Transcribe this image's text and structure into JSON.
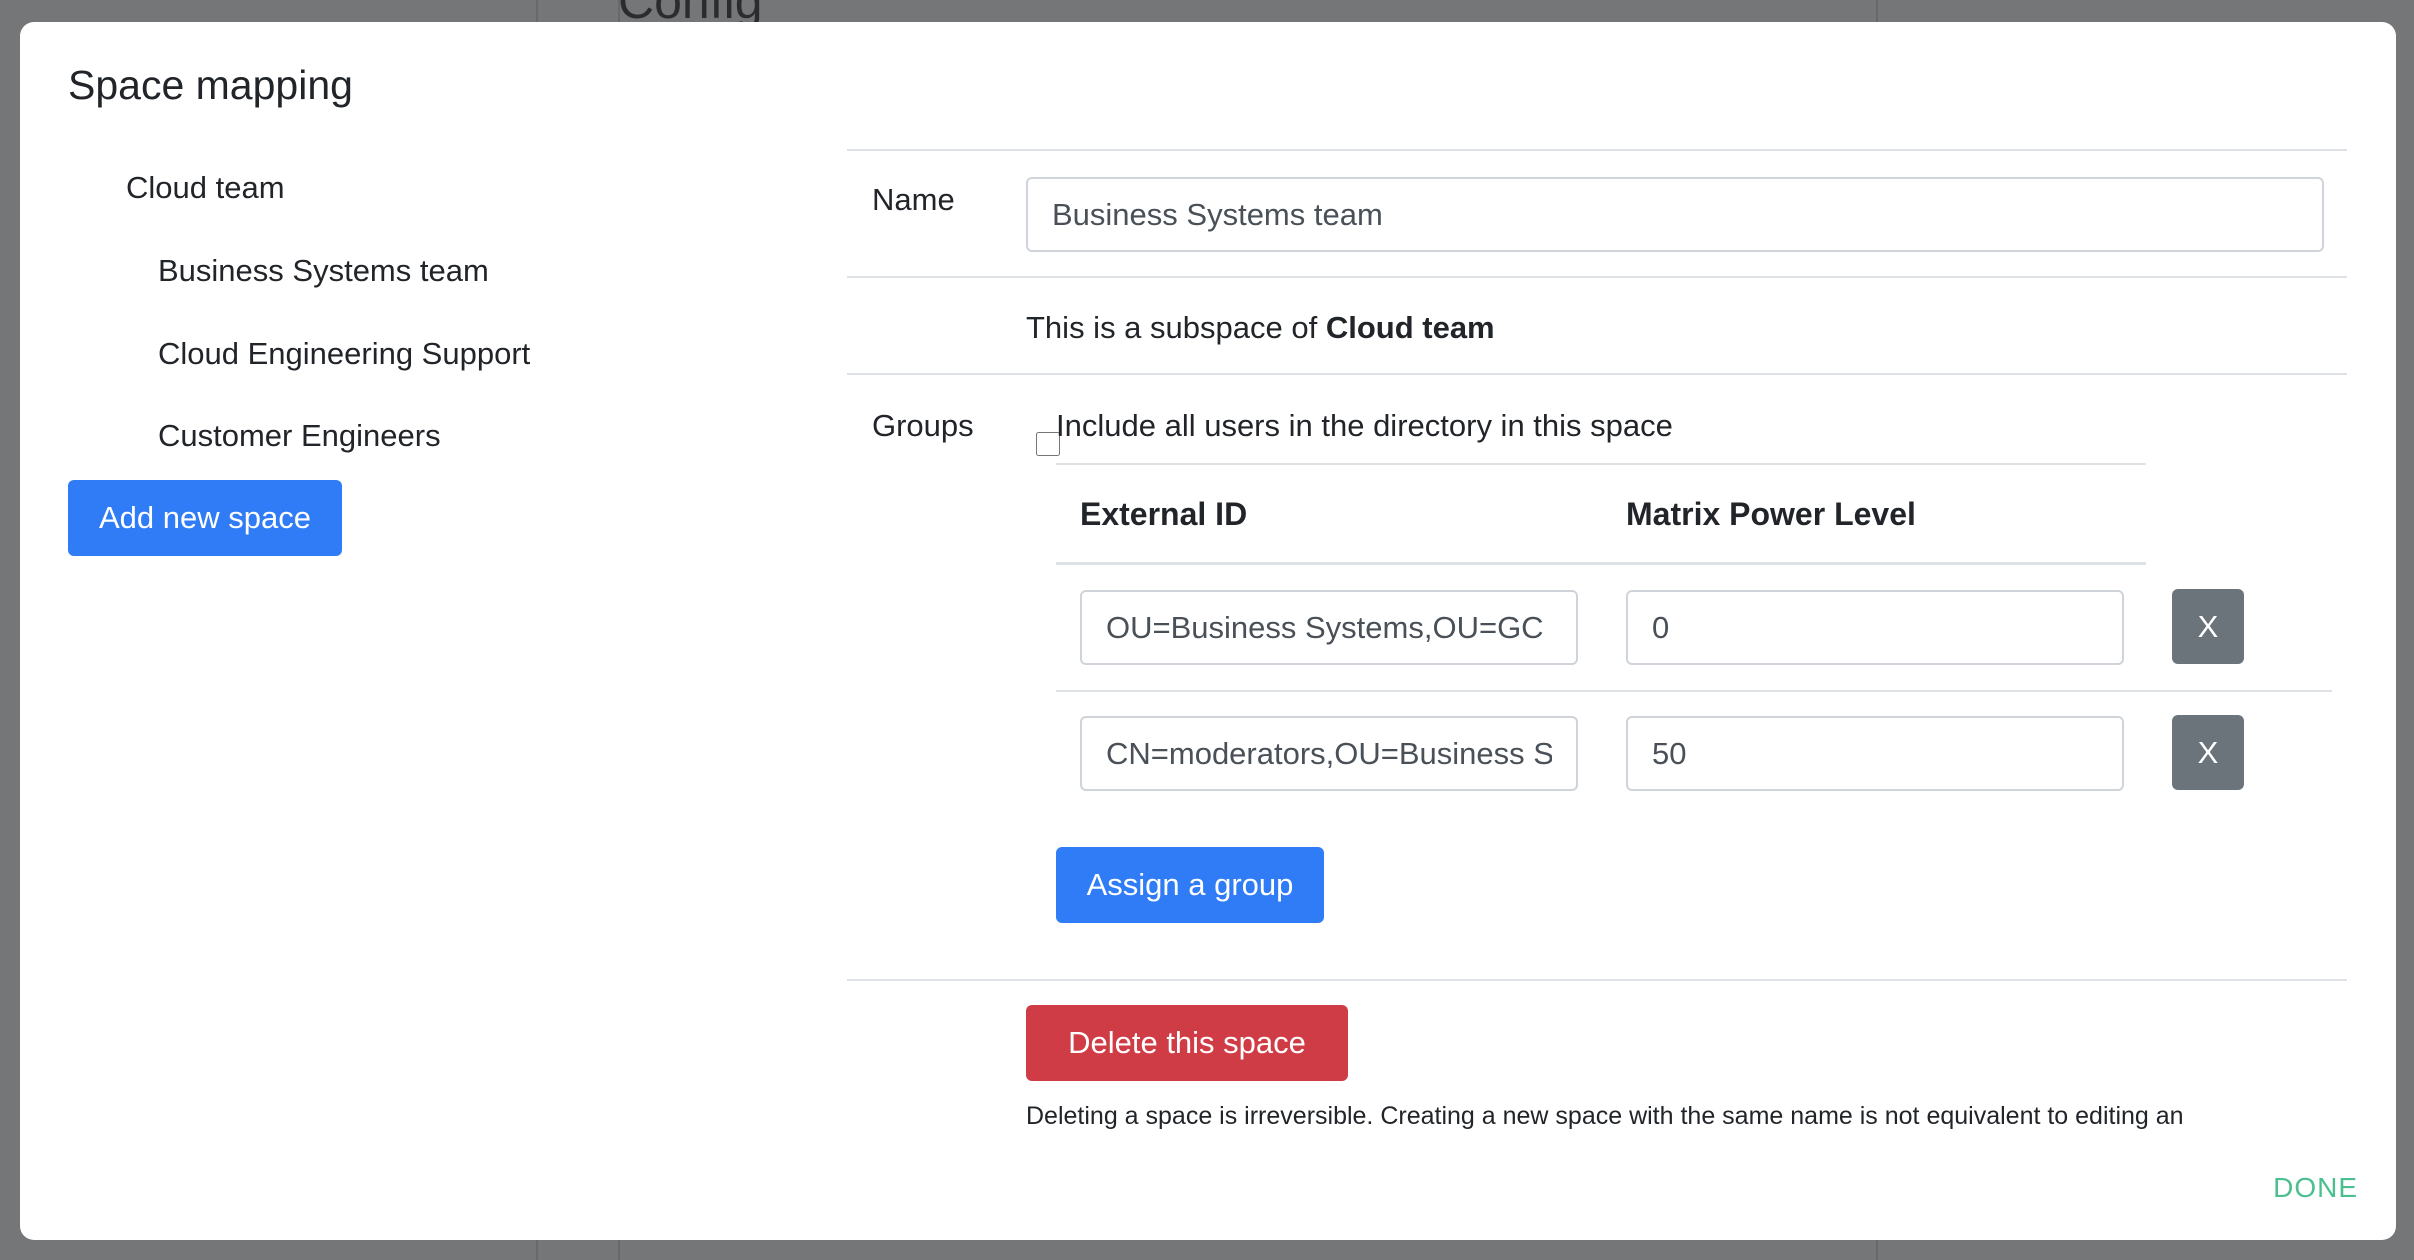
{
  "background": {
    "heading": "Config"
  },
  "modal": {
    "title": "Space mapping",
    "tree": [
      {
        "label": "Cloud team",
        "level": 0
      },
      {
        "label": "Business Systems team",
        "level": 1
      },
      {
        "label": "Cloud Engineering Support",
        "level": 1
      },
      {
        "label": "Customer Engineers",
        "level": 1
      }
    ],
    "add_space_label": "Add new space",
    "form": {
      "name_label": "Name",
      "name_value": "Business Systems team",
      "subspace_prefix": "This is a subspace of ",
      "subspace_parent": "Cloud team",
      "groups_label": "Groups",
      "include_all_label": "Include all users in the directory in this space",
      "include_all_checked": false,
      "table": {
        "col_external_id": "External ID",
        "col_power_level": "Matrix Power Level",
        "rows": [
          {
            "external_id": "OU=Business Systems,OU=GC",
            "power_level": "0",
            "remove_label": "X"
          },
          {
            "external_id": "CN=moderators,OU=Business Systems",
            "power_level": "50",
            "remove_label": "X"
          }
        ]
      },
      "assign_group_label": "Assign a group",
      "delete_label": "Delete this space",
      "delete_warning": "Deleting a space is irreversible. Creating a new space with the same name is not equivalent to editing an"
    },
    "done_label": "DONE"
  },
  "colors": {
    "primary": "#2f7cf6",
    "danger": "#d03c45",
    "secondary": "#6b737b",
    "done": "#4cbf8f"
  }
}
